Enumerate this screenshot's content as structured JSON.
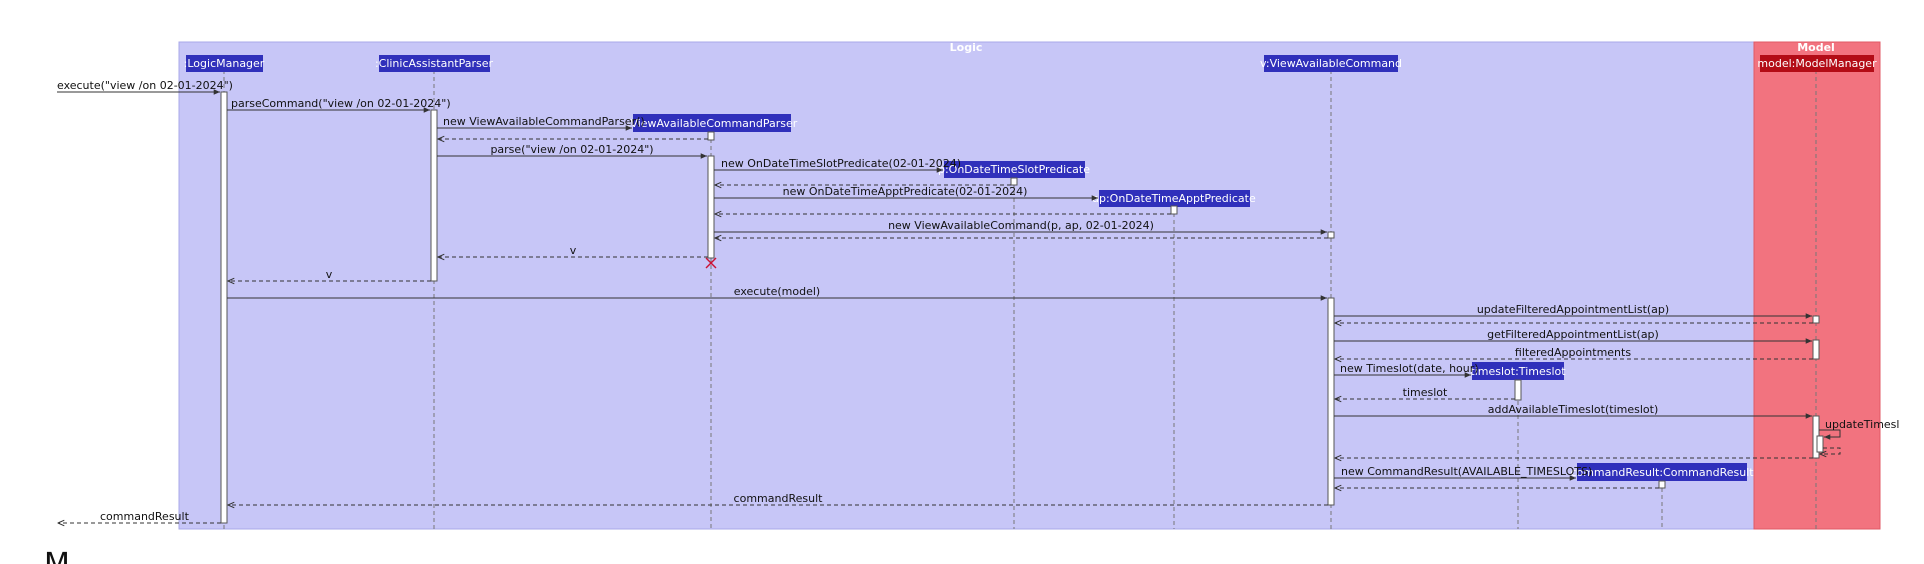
{
  "frames": {
    "logic_title": "Logic",
    "model_title": "Model"
  },
  "participants": {
    "logic_manager": ":LogicManager",
    "parser": ":ClinicAssistantParser",
    "command": "v:ViewAvailableCommand",
    "model_manager": "model:ModelManager",
    "command_parser": ":ViewAvailableCommandParser",
    "slot_predicate": "p:OnDateTimeSlotPredicate",
    "appt_predicate": "ap:OnDateTimeApptPredicate",
    "timeslot": "timeslot:Timeslot",
    "command_result": "commandResult:CommandResult"
  },
  "messages": {
    "m01": "execute(\"view /on 02-01-2024\")",
    "m02": "parseCommand(\"view /on 02-01-2024\")",
    "m03": "new ViewAvailableCommandParser()",
    "m04": "parse(\"view /on 02-01-2024\")",
    "m05": "new OnDateTimeSlotPredicate(02-01-2024)",
    "m06": "new OnDateTimeApptPredicate(02-01-2024)",
    "m07": "new ViewAvailableCommand(p, ap, 02-01-2024)",
    "m08": "v",
    "m09": "v",
    "m10": "execute(model)",
    "m11": "updateFilteredAppointmentList(ap)",
    "m12": "getFilteredAppointmentList(ap)",
    "m13": "filteredAppointments",
    "m14": "new Timeslot(date, hour)",
    "m15": "timeslot",
    "m16": "addAvailableTimeslot(timeslot)",
    "m17": "updateTimesl",
    "m18": "new CommandResult(AVAILABLE_TIMESLOTS)",
    "m19": "commandResult",
    "m20": "commandResult"
  },
  "footer_text": "M",
  "colors": {
    "logic_bg": "#c7c6f7",
    "model_bg": "#f2737f",
    "participant_box": "#3030bb",
    "model_box": "#b30c16",
    "destroy": "#cc1133"
  }
}
